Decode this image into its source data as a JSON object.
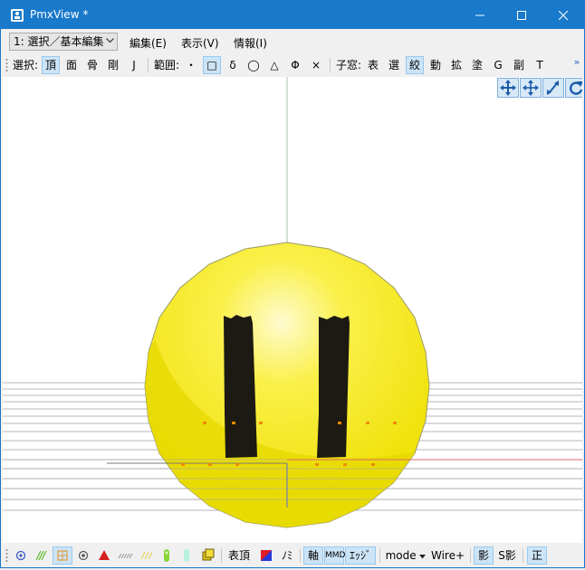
{
  "window": {
    "title": "PmxView *"
  },
  "menubar": {
    "mode_value": "1: 選択／基本編集",
    "edit": "編集(E)",
    "view": "表示(V)",
    "info": "情報(I)"
  },
  "toolbar": {
    "select_label": "選択:",
    "select_items": [
      "頂",
      "面",
      "骨",
      "剛",
      "J"
    ],
    "range_label": "範囲:",
    "range_items": [
      "・",
      "□",
      "δ",
      "◯",
      "△",
      "Φ",
      "×"
    ],
    "child_label": "子窓:",
    "child_items": [
      "表",
      "選",
      "絞",
      "動",
      "拡",
      "塗",
      "G",
      "副",
      "T"
    ],
    "overflow": "»"
  },
  "bottombar": {
    "vertex_label": "表頂",
    "mask_label": "ﾉﾐ",
    "axis_label": "軸",
    "mmd_label": "MMD",
    "edge_label": "ｴｯｼﾞ",
    "mode_label": "mode",
    "wire_label": "Wire+",
    "shadow_label": "影",
    "sshadow_label": "S影",
    "ortho_label": "正"
  },
  "colors": {
    "titlebar": "#1979ca",
    "selected_bg": "#cce4f7",
    "sphere": "#f2e60f"
  }
}
